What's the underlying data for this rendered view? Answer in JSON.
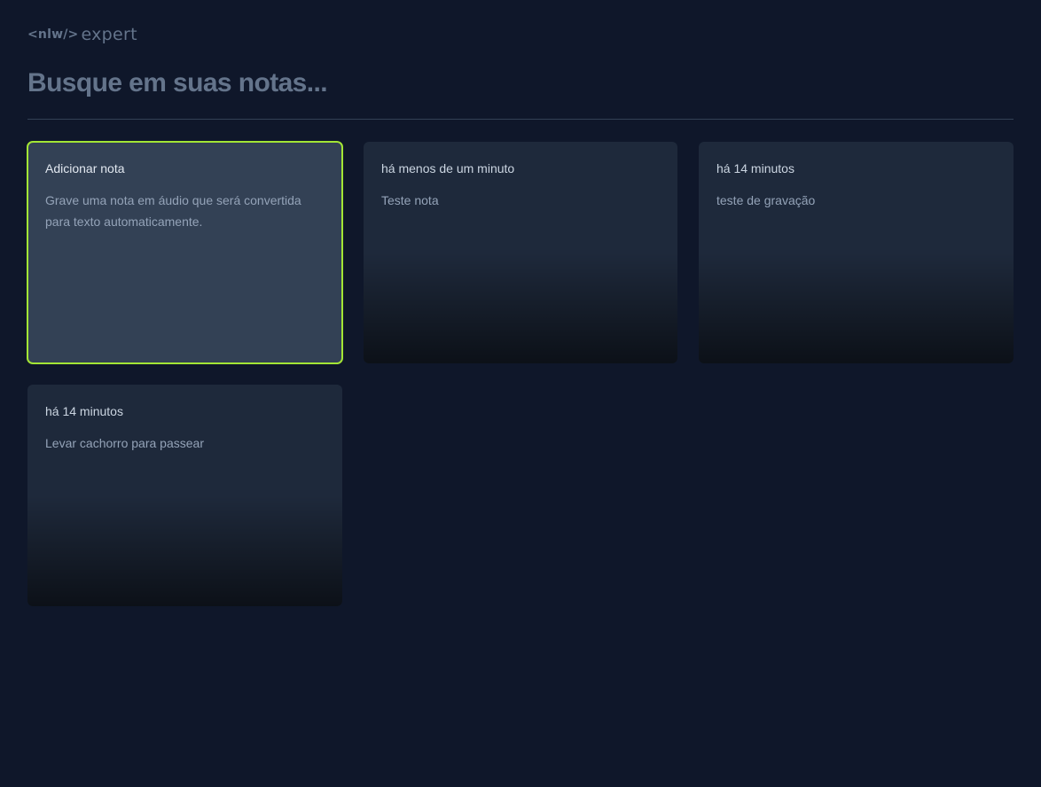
{
  "logo": {
    "code": "<nlw/>",
    "word": "expert"
  },
  "search": {
    "placeholder": "Busque em suas notas...",
    "value": ""
  },
  "new_note": {
    "title": "Adicionar nota",
    "description": "Grave uma nota em áudio que será convertida para texto automaticamente."
  },
  "notes": [
    {
      "date": "há menos de um minuto",
      "content": "Teste nota"
    },
    {
      "date": "há 14 minutos",
      "content": "teste de gravação"
    },
    {
      "date": "há 14 minutos",
      "content": "Levar cachorro para passear"
    }
  ],
  "colors": {
    "background": "#0f172a",
    "card": "#1e293b",
    "card_add": "#334155",
    "accent_outline": "#a3e635",
    "muted_text": "#64748b"
  }
}
